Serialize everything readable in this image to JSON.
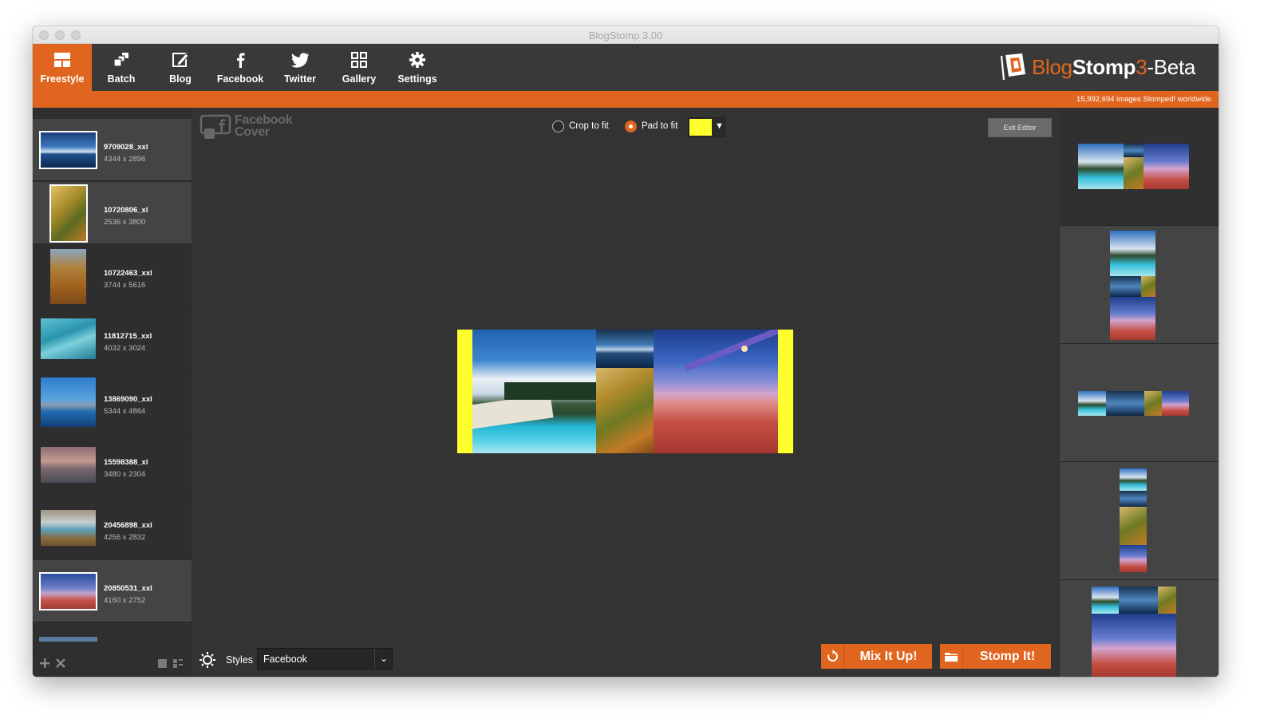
{
  "window": {
    "title": "BlogStomp 3.00"
  },
  "toolbar": {
    "items": [
      {
        "label": "Freestyle",
        "icon": "freestyle-icon"
      },
      {
        "label": "Batch",
        "icon": "batch-icon"
      },
      {
        "label": "Blog",
        "icon": "blog-icon"
      },
      {
        "label": "Facebook",
        "icon": "facebook-icon"
      },
      {
        "label": "Twitter",
        "icon": "twitter-icon"
      },
      {
        "label": "Gallery",
        "icon": "gallery-icon"
      },
      {
        "label": "Settings",
        "icon": "gear-icon"
      }
    ],
    "active": "Freestyle"
  },
  "brand": {
    "part1": "Blog",
    "part2": "Stomp",
    "part3": "3",
    "part4": "-Beta"
  },
  "stats": {
    "text": "15,992,694 images Stomped! worldwide"
  },
  "images": [
    {
      "name": "9709028_xxl",
      "dims": "4344 x 2896"
    },
    {
      "name": "10720806_xl",
      "dims": "2536 x 3800"
    },
    {
      "name": "10722463_xxl",
      "dims": "3744 x 5616"
    },
    {
      "name": "11812715_xxl",
      "dims": "4032 x 3024"
    },
    {
      "name": "13869090_xxl",
      "dims": "5344 x 4864"
    },
    {
      "name": "15598388_xl",
      "dims": "3480 x 2304"
    },
    {
      "name": "20456898_xxl",
      "dims": "4256 x 2832"
    },
    {
      "name": "20850531_xxl",
      "dims": "4160 x 2752"
    }
  ],
  "editor": {
    "preset_line1": "Facebook",
    "preset_line2": "Cover",
    "crop_label": "Crop to fit",
    "pad_label": "Pad to fit",
    "fit_mode": "pad",
    "pad_color": "#ffff2e",
    "exit_label": "Exit Editor"
  },
  "footer": {
    "styles_label": "Styles",
    "styles_value": "Facebook",
    "mix_label": "Mix It Up!",
    "stomp_label": "Stomp It!"
  },
  "colors": {
    "accent": "#e06620",
    "background": "#333333"
  }
}
